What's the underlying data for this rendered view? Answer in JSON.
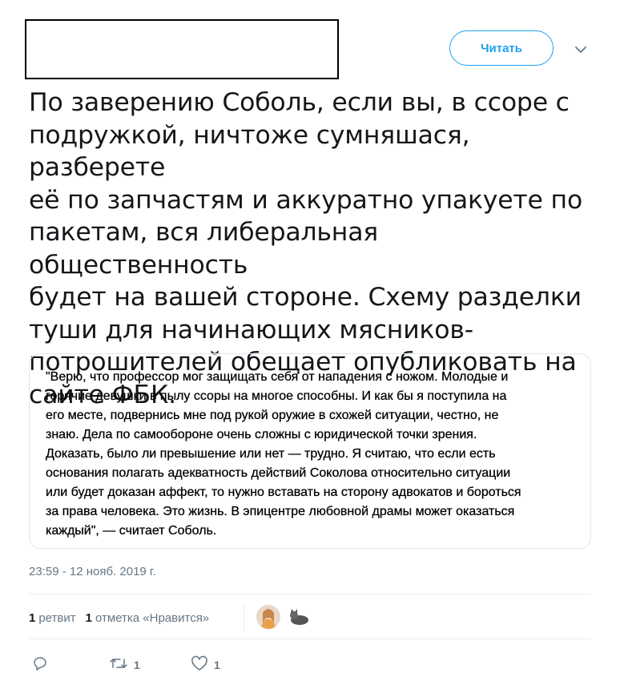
{
  "header": {
    "follow_label": "Читать",
    "chevron_icon": "chevron-down-icon",
    "accent_color": "#1da1f2"
  },
  "tweet": {
    "text": "По заверению Соболь, если вы, в ссоре с\nподружкой, ничтоже сумняшася, разберете\nеё по запчастям и аккуратно упакуете по\nпакетам, вся либеральная общественность\nбудет на вашей стороне. Схему разделки\nтуши для начинающих мясников-\nпотрошителей обещает опубликовать на\nсайте ФБК.",
    "quote": "\"Верю, что профессор мог защищать себя от нападения с ножом. Молодые и\nгорячие девушки в пылу ссоры на многое способны. И как бы я поступила на\nего месте, подвернись мне под рукой оружие в схожей ситуации, честно, не\nзнаю. Дела по самообороне очень сложны с юридической точки зрения.\nДоказать, было ли превышение или нет — трудно. Я считаю, что если есть\nоснования полагать адекватность действий Соколова относительно ситуации\nили будет доказан аффект, то нужно вставать на сторону адвокатов и бороться\nза права человека. Это жизнь. В эпицентре любовной драмы может оказаться\nкаждый\", — считает Соболь.",
    "timestamp": "23:59 - 12 нояб. 2019 г."
  },
  "stats": {
    "retweets_count": "1",
    "retweets_label": "ретвит",
    "likes_count": "1",
    "likes_label": "отметка «Нравится»"
  },
  "actions": {
    "reply_icon": "reply-icon",
    "retweet_icon": "retweet-icon",
    "retweet_count": "1",
    "like_icon": "heart-icon",
    "like_count": "1"
  }
}
